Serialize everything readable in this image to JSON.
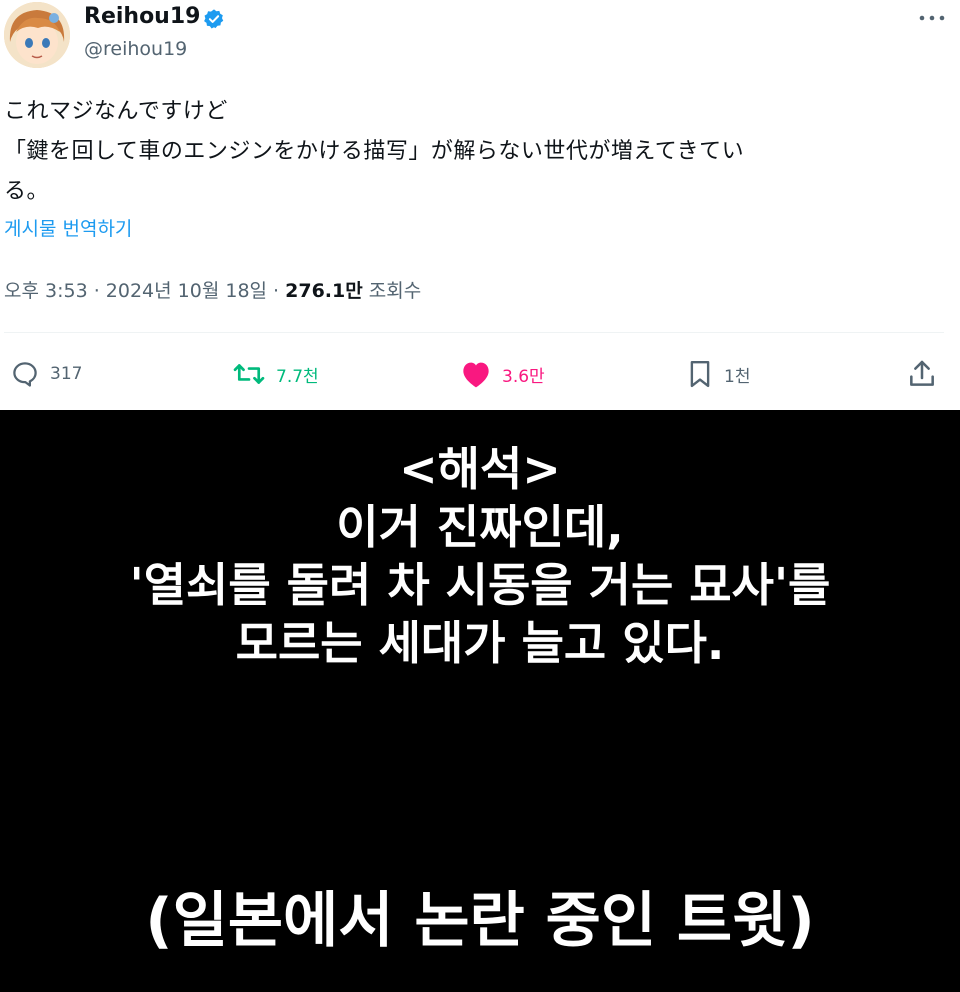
{
  "tweet": {
    "display_name": "Reihou19",
    "handle": "@reihou19",
    "body_lines": [
      "これマジなんですけど",
      "「鍵を回して車のエンジンをかける描写」が解らない世代が増えてきてい",
      "る。"
    ],
    "translate_label": "게시물 번역하기",
    "timestamp": "오후 3:53 · 2024년 10월 18일 · ",
    "views_count": "276.1만",
    "views_label": " 조회수",
    "actions": {
      "reply_count": "317",
      "retweet_count": "7.7천",
      "like_count": "3.6만",
      "bookmark_count": "1천"
    },
    "icons": {
      "verified": "verified-badge-icon",
      "more": "more-options-icon",
      "reply": "reply-icon",
      "retweet": "retweet-icon",
      "like": "heart-icon",
      "bookmark": "bookmark-icon",
      "share": "share-icon"
    },
    "colors": {
      "accent": "#1d9bf0",
      "retweet": "#00ba7c",
      "like": "#f91880",
      "muted": "#536471"
    }
  },
  "caption": {
    "lines": [
      "<해석>",
      "이거 진짜인데,",
      "'열쇠를 돌려 차 시동을 거는 묘사'를",
      "모르는 세대가 늘고 있다."
    ],
    "footer": "(일본에서 논란 중인 트윗)"
  }
}
